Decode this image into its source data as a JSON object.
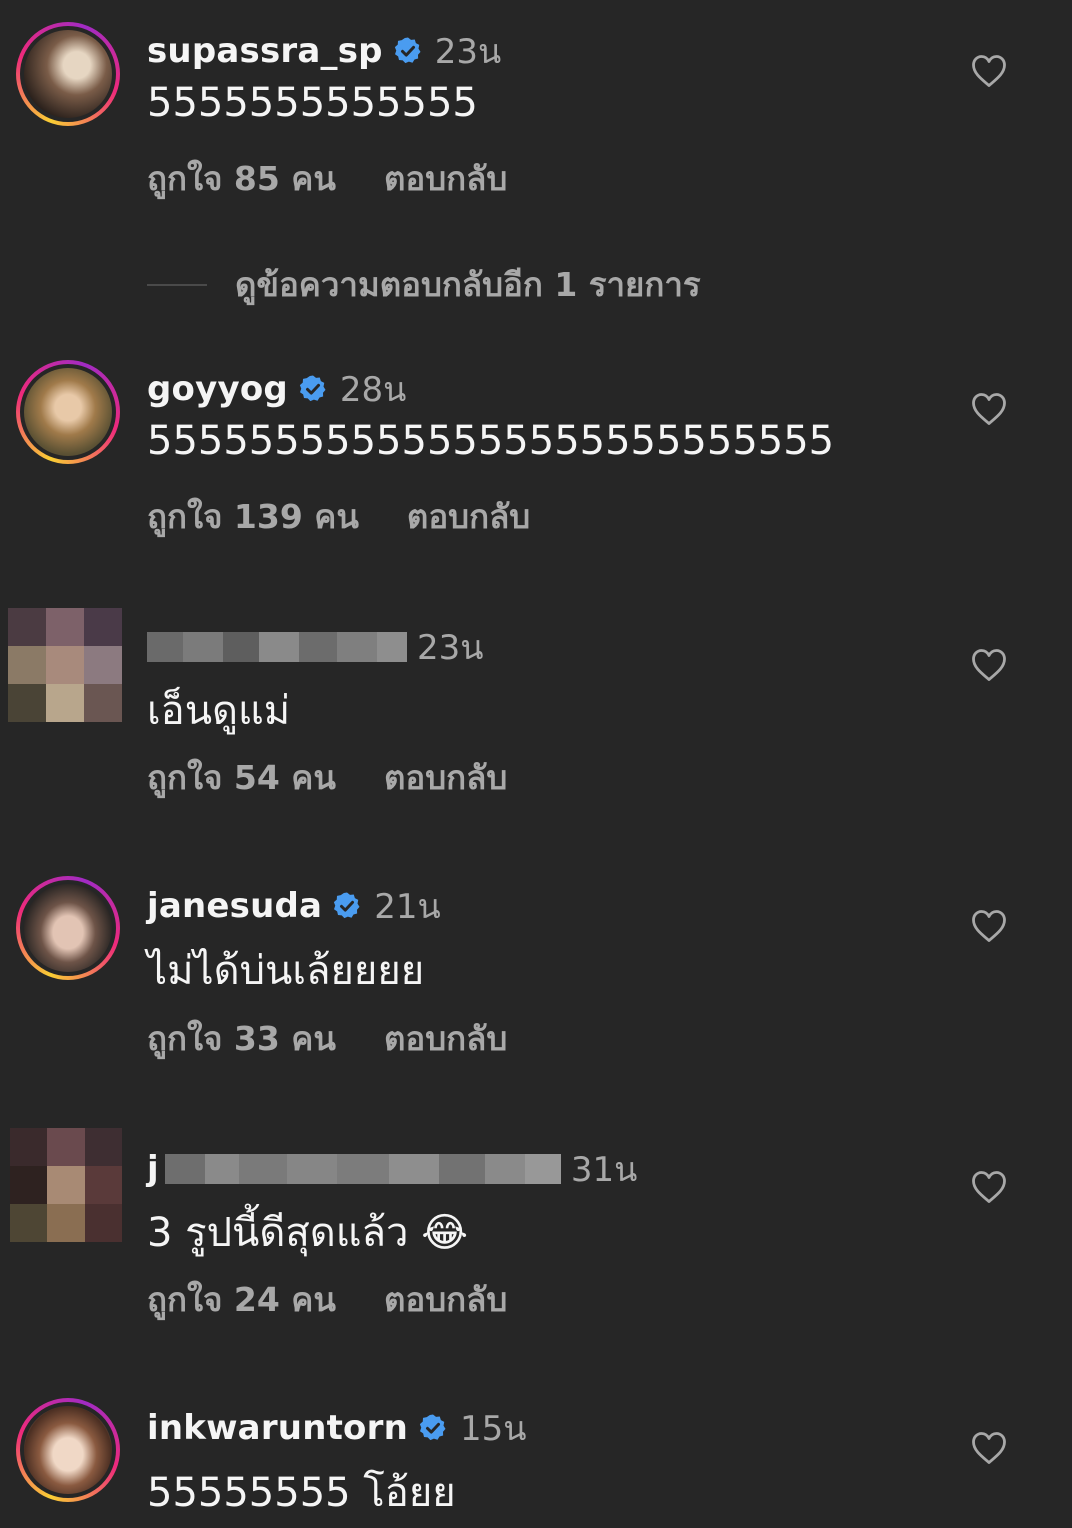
{
  "colors": {
    "background": "#262626",
    "primary_text": "#f5f5f5",
    "secondary_text": "#a8a8a8",
    "verified_badge": "#4a9cf0"
  },
  "icons": {
    "verified": "verified-badge-icon",
    "like": "heart-outline-icon"
  },
  "comments": [
    {
      "username": "supassra_sp",
      "verified": true,
      "time": "23น",
      "text": "5555555555555",
      "likes": "ถูกใจ 85 คน",
      "reply": "ตอบกลับ",
      "view_replies": "ดูข้อความตอบกลับอีก 1 รายการ"
    },
    {
      "username": "goyyog",
      "verified": true,
      "time": "28น",
      "text": "555555555555555555555555555",
      "likes": "ถูกใจ 139 คน",
      "reply": "ตอบกลับ"
    },
    {
      "username": "",
      "verified": false,
      "time": "23น",
      "text": "เอ็นดูแม่",
      "likes": "ถูกใจ 54 คน",
      "reply": "ตอบกลับ"
    },
    {
      "username": "janesuda",
      "verified": true,
      "time": "21น",
      "text": "ไม่ได้บ่นเล้ยยยย",
      "likes": "ถูกใจ 33 คน",
      "reply": "ตอบกลับ"
    },
    {
      "username": "j",
      "verified": false,
      "time": "31น",
      "text": "3 รูปนี้ดีสุดแล้ว 😂",
      "likes": "ถูกใจ 24 คน",
      "reply": "ตอบกลับ"
    },
    {
      "username": "inkwaruntorn",
      "verified": true,
      "time": "15น",
      "text": "55555555 โอ้ยย"
    }
  ]
}
